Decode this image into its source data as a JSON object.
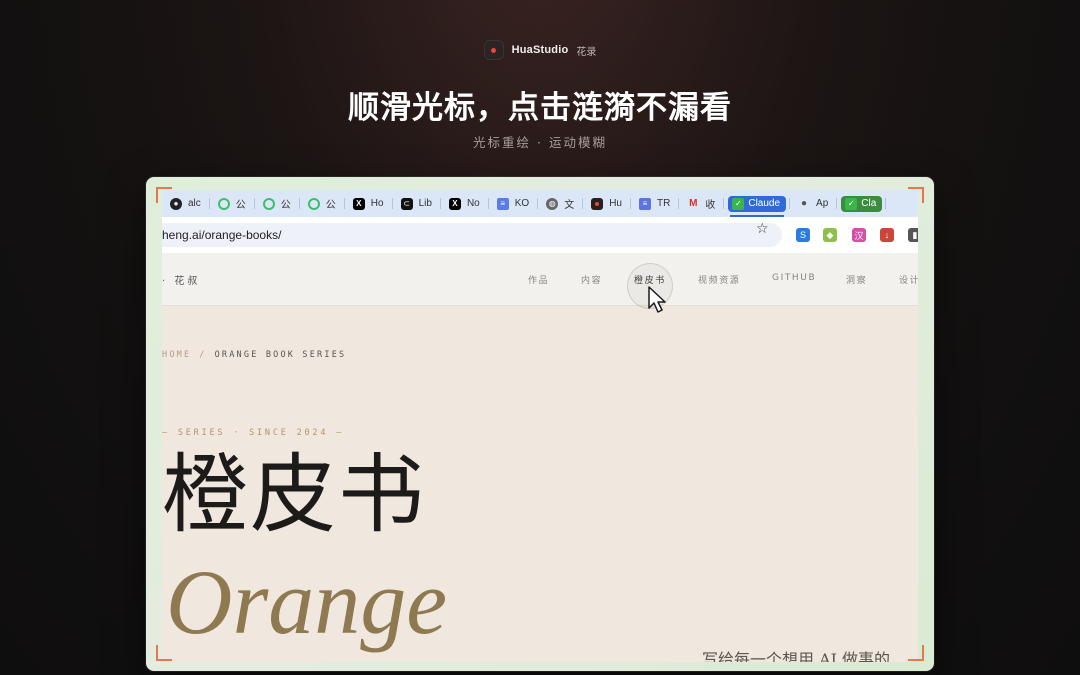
{
  "brand": {
    "name": "HuaStudio",
    "sub": "花录"
  },
  "headline": "顺滑光标，点击涟漪不漏看",
  "subline": "光标重绘 · 运动模糊",
  "browser": {
    "tabs": [
      {
        "label": "alc",
        "icon": "github-icon"
      },
      {
        "label": "公",
        "icon": "wechat-icon"
      },
      {
        "label": "公",
        "icon": "wechat-icon"
      },
      {
        "label": "公",
        "icon": "wechat-icon"
      },
      {
        "label": "Ho",
        "icon": "x-icon"
      },
      {
        "label": "Lib",
        "icon": "link-icon"
      },
      {
        "label": "No",
        "icon": "x-icon"
      },
      {
        "label": "KO",
        "icon": "doc-icon"
      },
      {
        "label": "文",
        "icon": "globe-icon"
      },
      {
        "label": "Hu",
        "icon": "record-icon"
      },
      {
        "label": "TR",
        "icon": "doc-icon"
      },
      {
        "label": "收",
        "icon": "gmail-icon"
      },
      {
        "label": "Claude",
        "icon": "check-icon",
        "style": "pill"
      },
      {
        "label": "Ap",
        "icon": "apple-icon"
      },
      {
        "label": "Cla",
        "icon": "check-icon",
        "style": "pill-green"
      }
    ],
    "url": "heng.ai/orange-books/",
    "star": "☆"
  },
  "site": {
    "brand": "· 花叔",
    "nav": [
      "作品",
      "内容",
      "橙皮书",
      "视频资源",
      "GITHUB",
      "洞察",
      "设计"
    ],
    "active_nav": "橙皮书"
  },
  "page": {
    "breadcrumb_home": "HOME",
    "breadcrumb_sep": "/",
    "breadcrumb_current": "ORANGE BOOK SERIES",
    "series": "— SERIES · SINCE 2024 —",
    "title_cn": "橙皮书",
    "title_en": "Orange",
    "bottom_text": "写给每一个想用 AI 做事的"
  },
  "colors": {
    "accent_corner": "#e27a4c",
    "tab_active": "#2e6bd9",
    "title_gold": "#8f7950",
    "page_bg": "#f0e8df"
  }
}
